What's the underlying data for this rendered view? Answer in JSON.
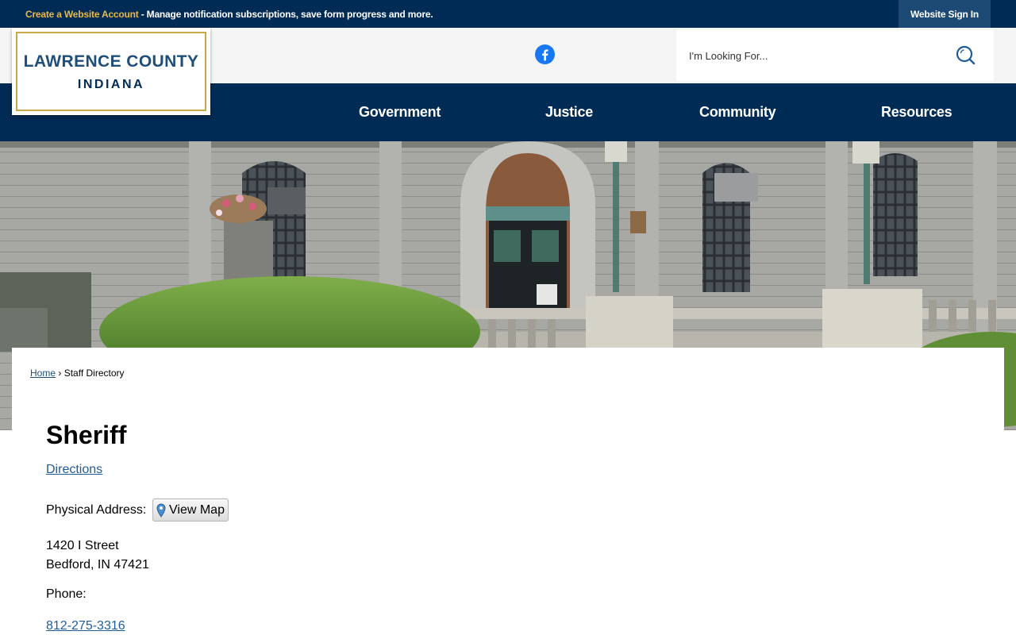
{
  "topbar": {
    "account_link": "Create a Website Account",
    "account_text": " - Manage notification subscriptions, save form progress and more.",
    "sign_in": "Website Sign In"
  },
  "logo": {
    "line1": "LAWRENCE COUNTY",
    "line2": "INDIANA"
  },
  "search": {
    "placeholder": "I'm Looking For..."
  },
  "nav": {
    "items": [
      "Government",
      "Justice",
      "Community",
      "Resources"
    ]
  },
  "breadcrumb": {
    "home": "Home",
    "separator": " › ",
    "current": "Staff Directory"
  },
  "page": {
    "title": "Sheriff",
    "directions": "Directions",
    "physical_address_label": "Physical Address:",
    "view_map": "View Map",
    "address_line1": "1420 I Street",
    "address_line2": "Bedford, IN 47421",
    "phone_label": "Phone:",
    "phone": "812-275-3316"
  },
  "colors": {
    "navy": "#002b55",
    "gold": "#c8a847",
    "link": "#1f5c99",
    "facebook": "#1877f2"
  },
  "icons": [
    "facebook-icon",
    "search-icon",
    "map-pin-icon"
  ]
}
